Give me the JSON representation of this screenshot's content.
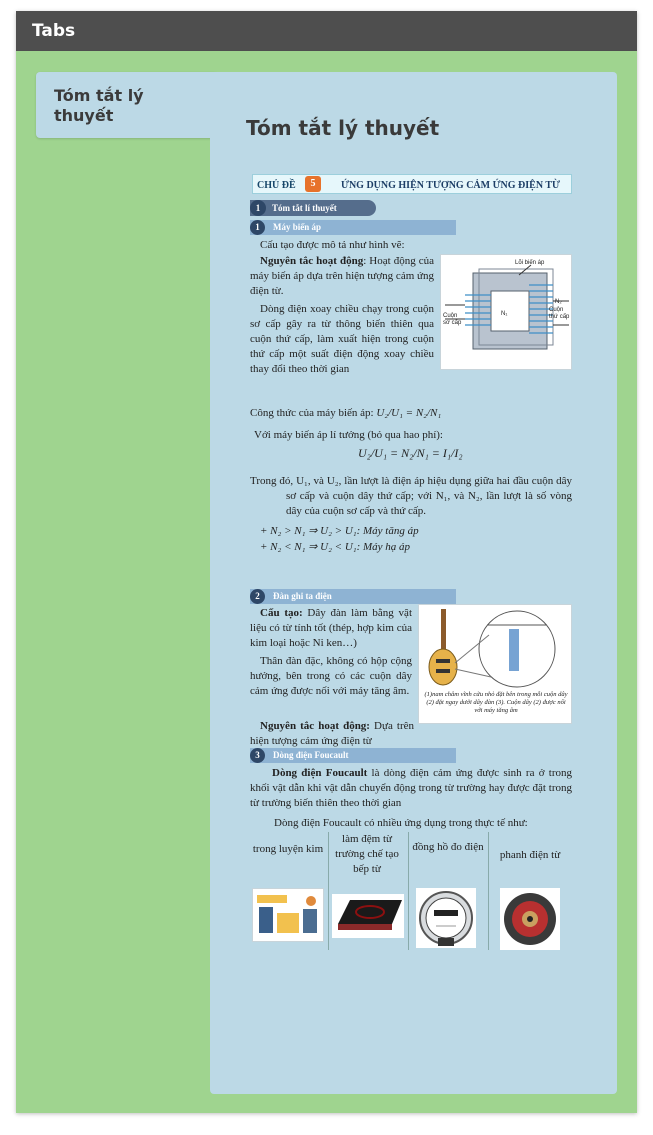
{
  "app": {
    "title": "Tabs"
  },
  "tabs": [
    {
      "label": "Tóm tắt lý thuyết"
    }
  ],
  "content": {
    "heading": "Tóm tắt lý thuyết",
    "topic": {
      "prefix": "CHỦ ĐỀ",
      "number": "5",
      "title": "ỨNG DỤNG HIỆN TƯỢNG CẢM ỨNG ĐIỆN TỪ"
    },
    "section1": {
      "number": "1",
      "title": "Tóm tắt lí thuyết"
    },
    "sub1": {
      "number": "1",
      "title": "Máy biến áp"
    },
    "sub1_intro": "Cấu tạo được mô tả như hình vẽ:",
    "sub1_principle_label": "Nguyên tắc hoạt động",
    "sub1_principle": ": Hoạt động của máy biến áp dựa trên hiện tượng cảm ứng điện từ.",
    "sub1_p2": "Dòng điện xoay chiều chạy trong cuộn sơ cấp gây ra từ thông biến thiên qua cuộn thứ cấp, làm xuất hiện trong cuộn thứ cấp một suất điện động xoay chiều thay đổi theo thời gian",
    "sub1_formula_label": "Công thức của máy biến áp:",
    "sub1_formula": "U₂/U₁ = N₂/N₁",
    "sub1_ideal": "Với máy biến áp lí tưởng (bỏ qua hao phí):",
    "sub1_ideal_formula": "U₂/U₁ = N₂/N₁ = I₁/I₂",
    "sub1_where": "Trong đó, U₁, và U₂, lần lượt là điện áp hiệu dụng giữa hai đầu cuộn dây sơ cấp và cuộn dây thứ cấp; với N₁, và N₂, lần lượt là số vòng dây của cuộn sơ cấp và thứ cấp.",
    "sub1_step_up": "+ N₂ > N₁ ⇒ U₂ > U₁: Máy tăng áp",
    "sub1_step_down": "+ N₂ < N₁ ⇒ U₂ < U₁: Máy hạ áp",
    "transformer_labels": {
      "core": "Lõi biến áp",
      "primary": "Cuộn sơ cấp",
      "secondary": "Cuộn thứ cấp",
      "n1": "N₁",
      "n2": "N₂"
    },
    "sub2": {
      "number": "2",
      "title": "Đàn ghi ta điện"
    },
    "sub2_structure_label": "Cấu tạo:",
    "sub2_structure": " Dây đàn làm bằng vật liệu có từ tính tốt (thép, hợp kim của kim loại hoặc Ni ken…)",
    "sub2_body": "Thân đàn đặc, không có hộp cộng hưởng, bên trong có các cuộn dây cảm ứng được nối với máy tăng âm.",
    "sub2_principle_label": "Nguyên tắc hoạt động:",
    "sub2_principle": " Dựa trên hiện tượng cảm ứng điện từ",
    "guitar_caption": "(1)nam châm vĩnh cửu nhỏ đặt bên trong mỗi cuộn dây (2) đặt ngay dưới dây đàn (3). Cuộn dây (2) được nối với máy tăng âm",
    "sub3": {
      "number": "3",
      "title": "Dòng điện Foucault"
    },
    "sub3_label": "Dòng điện Foucault",
    "sub3_text": " là dòng điện cảm ứng được sinh ra ở trong khối vật dẫn khi vật dẫn chuyển động trong từ trường hay được đặt trong từ trường biến thiên theo thời gian",
    "sub3_apps_intro": "Dòng điện Foucault có nhiều ứng dụng trong thực tế như:",
    "applications": [
      {
        "label": "trong luyện kim"
      },
      {
        "label": "làm đệm từ trường chế tạo bếp từ"
      },
      {
        "label": "đồng hồ đo điện"
      },
      {
        "label": "phanh điện từ"
      }
    ]
  }
}
